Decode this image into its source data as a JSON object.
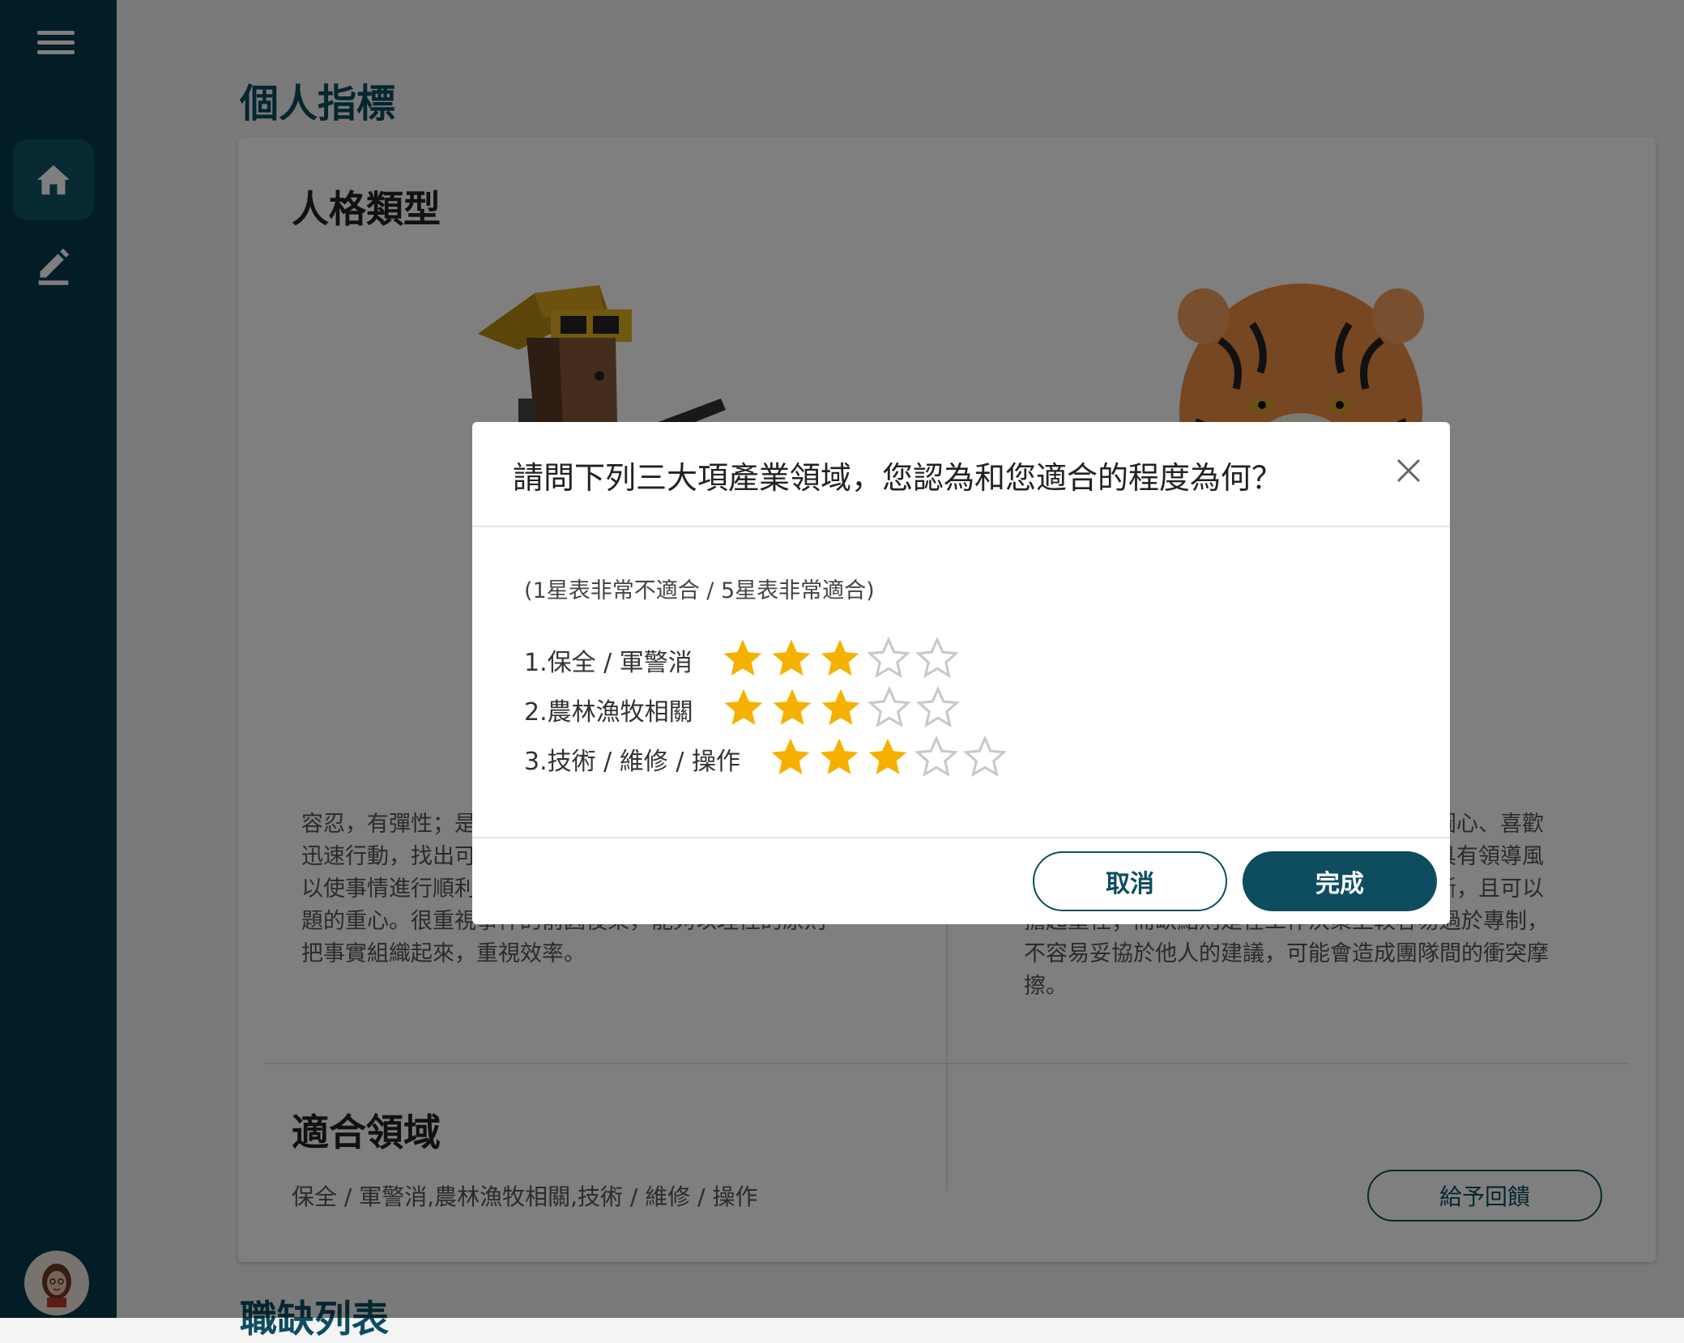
{
  "page": {
    "title": "個人指標",
    "next_section_title": "職缺列表"
  },
  "personality": {
    "title": "人格類型",
    "left_description": [
      "容忍，有彈性；是",
      "迅速行動，找出可",
      "以使事情進行順利",
      "題的重心。很重視事件的前因後果，能夠以理性的原則",
      "把事實組織起來，重視效率。"
    ],
    "right_description": [
      "企圖心、喜歡",
      "富具有領導風",
      "果斷，且可以",
      "擔起重任；而缺點則是在工作決策上較容易過於專制，",
      "不容易妥協於他人的建議，可能會造成團隊間的衝突摩",
      "擦。"
    ]
  },
  "fields": {
    "title": "適合領域",
    "value": "保全 / 軍警消,農林漁牧相關,技術 / 維修 / 操作",
    "feedback_button": "給予回饋"
  },
  "modal": {
    "title": "請問下列三大項產業領域，您認為和您適合的程度為何？",
    "hint": "(1星表非常不適合 / 5星表非常適合)",
    "max_stars": 5,
    "ratings": [
      {
        "label": "1.保全 / 軍警消",
        "value": 3
      },
      {
        "label": "2.農林漁牧相關",
        "value": 3
      },
      {
        "label": "3.技術 / 維修 / 操作",
        "value": 3
      }
    ],
    "cancel_label": "取消",
    "done_label": "完成"
  },
  "colors": {
    "sidebar": "#053b4a",
    "accent": "#0d4d5f",
    "star_filled": "#f6b100",
    "star_empty": "#c8c8c8"
  },
  "icons": {
    "menu": "hamburger-menu-icon",
    "home": "home-icon",
    "edit": "edit-pencil-icon",
    "close": "close-icon",
    "star": "star-icon"
  }
}
